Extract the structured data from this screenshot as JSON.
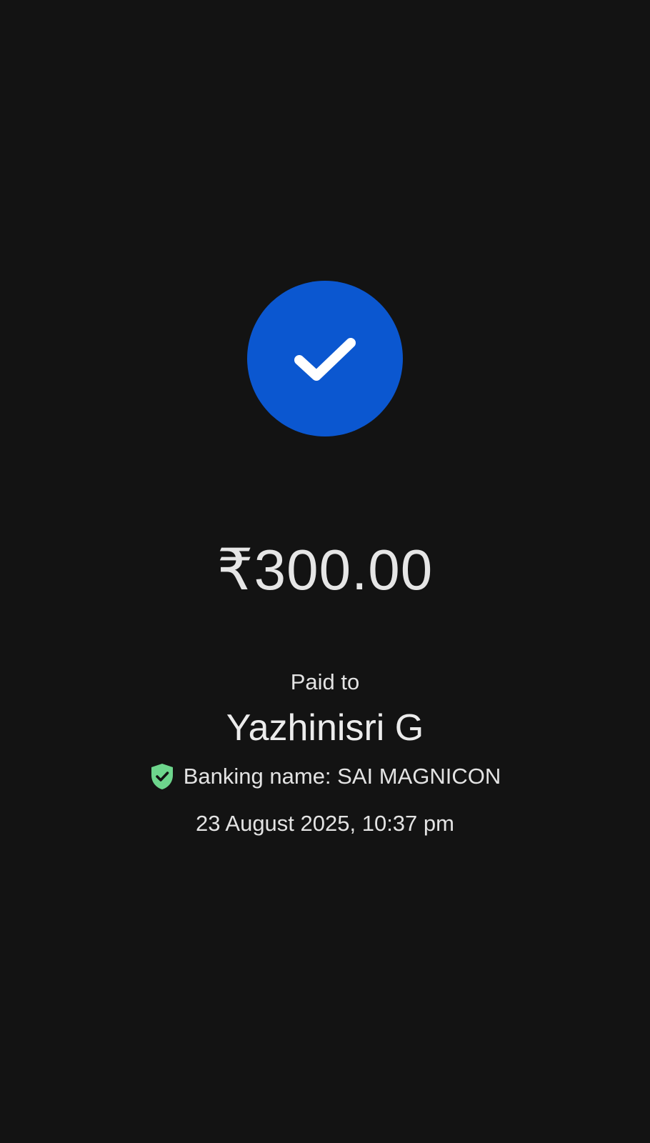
{
  "status": {
    "icon": "checkmark-icon",
    "circle_color": "#0b57d0"
  },
  "payment": {
    "amount": "₹300.00",
    "paid_to_label": "Paid to",
    "payee_name": "Yazhinisri G",
    "verified_icon": "shield-check-icon",
    "verified_color": "#6dd58c",
    "banking_name": "Banking name: SAI MAGNICON",
    "timestamp": "23 August 2025, 10:37 pm"
  }
}
